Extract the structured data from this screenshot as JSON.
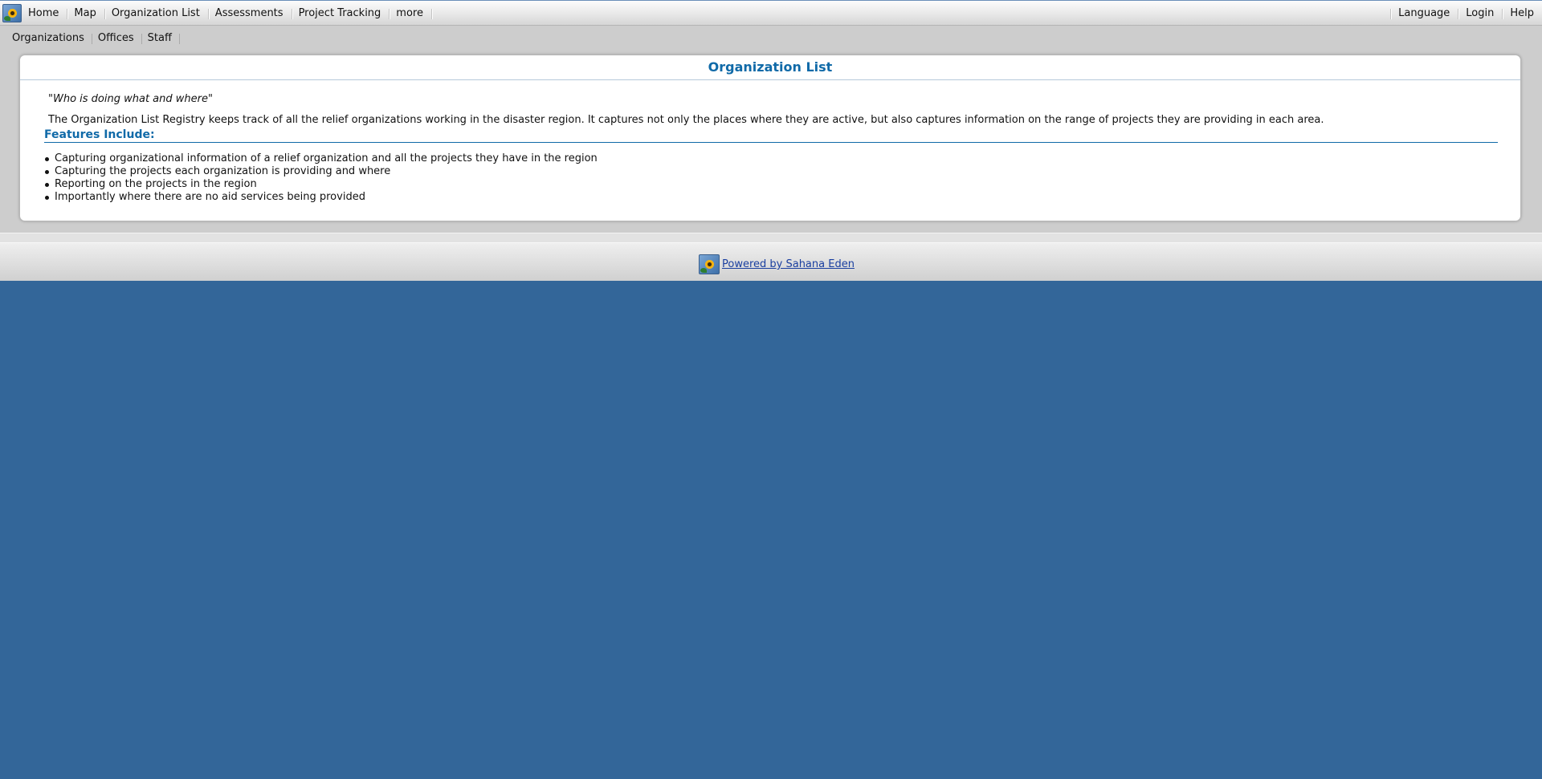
{
  "top_nav": {
    "left_items": [
      "Home",
      "Map",
      "Organization List",
      "Assessments",
      "Project Tracking",
      "more"
    ],
    "right_items": [
      "Language",
      "Login",
      "Help"
    ],
    "logo_icon": "sahana-sunflower-icon"
  },
  "sub_nav": {
    "items": [
      "Organizations",
      "Offices",
      "Staff"
    ]
  },
  "main": {
    "title": "Organization List",
    "tagline": "\"Who is doing what and where\"",
    "description": "The Organization List Registry keeps track of all the relief organizations working in the disaster region. It captures not only the places where they are active, but also captures information on the range of projects they are providing in each area.",
    "features_heading": "Features Include:",
    "features": [
      "Capturing organizational information of a relief organization and all the projects they have in the region",
      "Capturing the projects each organization is providing and where",
      "Reporting on the projects in the region",
      "Importantly where there are no aid services being provided"
    ]
  },
  "footer": {
    "link_text": "Powered by Sahana Eden",
    "logo_icon": "sahana-sunflower-icon"
  },
  "colors": {
    "page_background": "#336699",
    "accent": "#106aa8",
    "link": "#1a3fa0"
  }
}
